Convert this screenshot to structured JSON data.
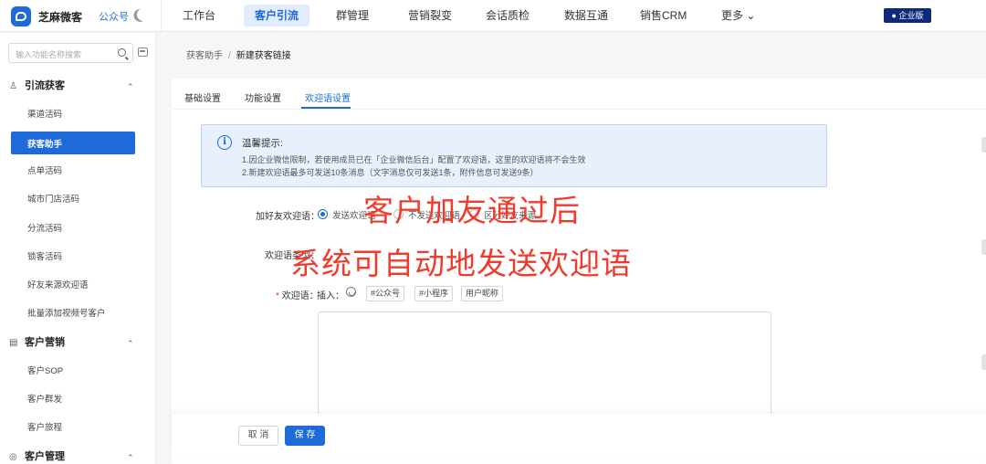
{
  "topbar": {
    "brand": "芝麻微客",
    "account": "公众号",
    "nav": [
      "工作台",
      "客户引流",
      "群管理",
      "营销裂变",
      "会话质检",
      "数据互通",
      "销售CRM",
      "更多 ⌄"
    ],
    "enterprise_badge": "企业版"
  },
  "sidebar": {
    "search_placeholder": "输入功能名称搜索",
    "groups": [
      {
        "title": "引流获客",
        "items": [
          "渠道活码",
          "获客助手",
          "点单活码",
          "城市门店活码",
          "分流活码",
          "锁客活码",
          "好友来源欢迎语",
          "批量添加视频号客户"
        ]
      },
      {
        "title": "客户营销",
        "items": [
          "客户SOP",
          "客户群发",
          "客户旅程"
        ]
      },
      {
        "title": "客户管理",
        "items": []
      }
    ],
    "caret": "⌃"
  },
  "breadcrumb": {
    "parent": "获客助手",
    "separator": "/",
    "current": "新建获客链接"
  },
  "tabs": [
    "基础设置",
    "功能设置",
    "欢迎语设置"
  ],
  "alert": {
    "title": "温馨提示:",
    "line1": "1.因企业微信限制，若使用成员已在「企业微信后台」配置了欢迎语，这里的欢迎语将不会生效",
    "line2": "2.新建欢迎语最多可发送10条消息（文字消息仅可发送1条，附件信息可发送9条）"
  },
  "form": {
    "add_friend_label": "加好友欢迎语：",
    "option_send": "发送欢迎语",
    "option_nosend": "不发送欢迎语",
    "option_other": "区分好友来源",
    "greeting_type_label": "欢迎语类型：",
    "greeting_label": "欢迎语：",
    "required_mark": "*",
    "insert_label": "插入：",
    "tags": [
      "#公众号",
      "#小程序",
      "用户昵称"
    ]
  },
  "overlay": {
    "line1": "客户加友通过后",
    "line2": "系统可自动地发送欢迎语"
  },
  "footer": {
    "cancel": "取 消",
    "save": "保 存"
  }
}
